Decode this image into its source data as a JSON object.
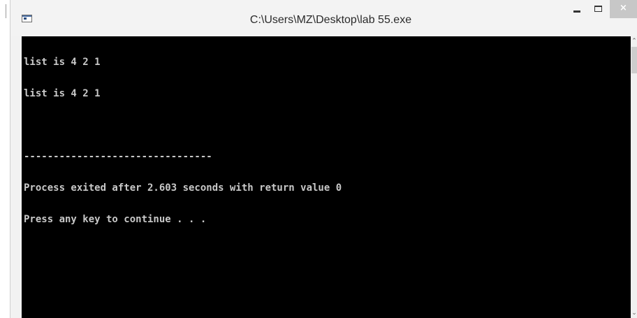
{
  "window": {
    "title": "C:\\Users\\MZ\\Desktop\\lab 55.exe",
    "icon": "console-app-icon",
    "controls": {
      "minimize_icon": "minimize-icon",
      "maximize_icon": "maximize-icon",
      "close_icon": "close-icon",
      "close_glyph": "×"
    }
  },
  "console": {
    "lines": [
      "list is 4 2 1",
      "list is 4 2 1",
      "",
      "--------------------------------",
      "Process exited after 2.603 seconds with return value 0",
      "Press any key to continue . . ."
    ]
  },
  "scrollbar": {
    "up_glyph": "⌃",
    "down_glyph": "⌄"
  },
  "colors": {
    "console_background": "#000000",
    "console_text": "#c8c8c8",
    "titlebar": "#f3f3f3",
    "close_button": "#c7c7c7"
  }
}
